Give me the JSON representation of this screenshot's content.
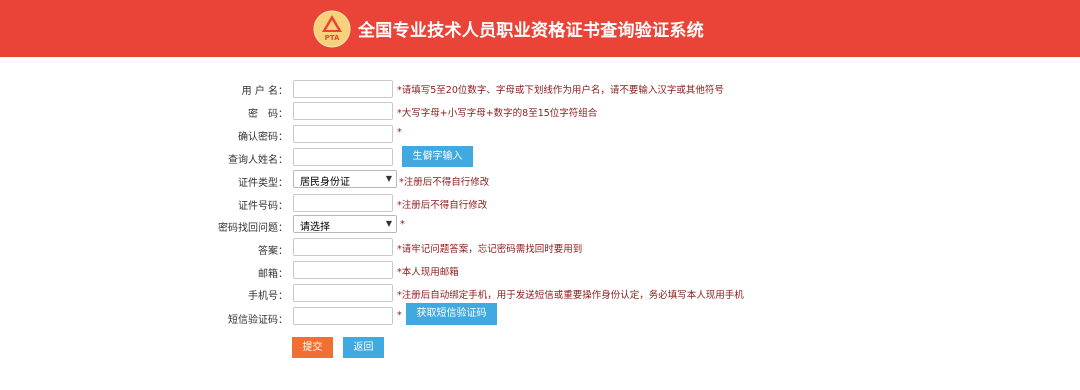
{
  "header": {
    "title": "全国专业技术人员职业资格证书查询验证系统",
    "logo_text": "PTA",
    "bg_color": "#e94437"
  },
  "form": {
    "username": {
      "label": "用 户 名：",
      "value": "",
      "hint": "*请填写5至20位数字、字母或下划线作为用户名，请不要输入汉字或其他符号"
    },
    "password": {
      "label": "密　码：",
      "value": "",
      "hint": "*大写字母+小写字母+数字的8至15位字符组合"
    },
    "confirm_password": {
      "label": "确认密码：",
      "value": "",
      "hint": "*"
    },
    "query_name": {
      "label": "查询人姓名：",
      "value": "",
      "rare_char_button": "生僻字输入"
    },
    "cert_type": {
      "label": "证件类型：",
      "selected": "居民身份证",
      "hint": "*注册后不得自行修改"
    },
    "cert_number": {
      "label": "证件号码：",
      "value": "",
      "hint": "*注册后不得自行修改"
    },
    "security_question": {
      "label": "密码找回问题：",
      "selected": "请选择",
      "hint": "*"
    },
    "answer": {
      "label": "答案：",
      "value": "",
      "hint": "*请牢记问题答案，忘记密码需找回时要用到"
    },
    "email": {
      "label": "邮箱：",
      "value": "",
      "hint": "*本人现用邮箱"
    },
    "phone": {
      "label": "手机号：",
      "value": "",
      "hint": "*注册后自动绑定手机，用于发送短信或重要操作身份认定，务必填写本人现用手机"
    },
    "sms_code": {
      "label": "短信验证码：",
      "value": "",
      "hint": "*",
      "get_code_button": "获取短信验证码"
    }
  },
  "actions": {
    "submit_label": "提交",
    "back_label": "返回"
  },
  "colors": {
    "accent_blue": "#3fa9e0",
    "accent_orange": "#f07033",
    "hint_red": "#8b1a1a"
  }
}
